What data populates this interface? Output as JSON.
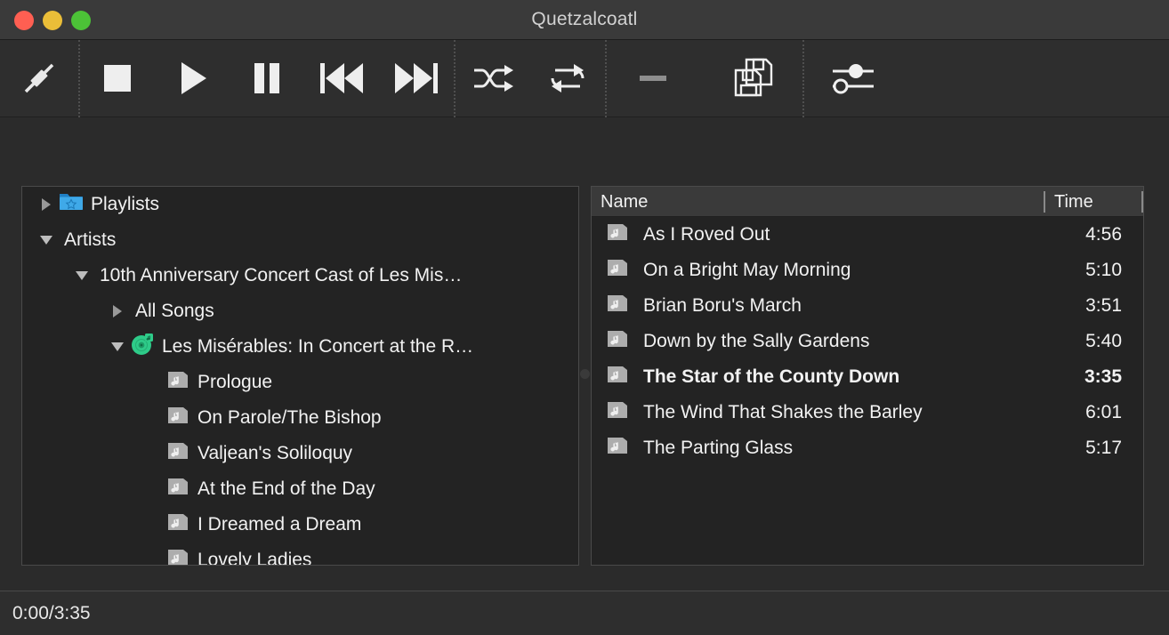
{
  "window": {
    "title": "Quetzalcoatl",
    "controls": [
      {
        "name": "close-button",
        "color": "#ff5f52"
      },
      {
        "name": "minimize-button",
        "color": "#ebbe38"
      },
      {
        "name": "maximize-button",
        "color": "#4cc237"
      }
    ]
  },
  "toolbar": {
    "buttons": [
      {
        "icon": "connect-icon",
        "label": "Connect"
      },
      {
        "icon": "stop-icon",
        "label": "Stop"
      },
      {
        "icon": "play-icon",
        "label": "Play"
      },
      {
        "icon": "pause-icon",
        "label": "Pause"
      },
      {
        "icon": "previous-icon",
        "label": "Previous"
      },
      {
        "icon": "next-icon",
        "label": "Next"
      },
      {
        "icon": "shuffle-icon",
        "label": "Shuffle"
      },
      {
        "icon": "repeat-icon",
        "label": "Repeat"
      },
      {
        "icon": "minus-icon",
        "label": "Remove"
      },
      {
        "icon": "save-icon",
        "label": "Save"
      },
      {
        "icon": "equalizer-icon",
        "label": "Equalizer"
      }
    ]
  },
  "seek": {
    "value": 0,
    "min": 0,
    "max": 100
  },
  "tree": {
    "rows": [
      {
        "depth": 0,
        "twisty": "right",
        "icon": "playlists-folder-icon",
        "label": "Playlists",
        "name": "tree-item-playlists"
      },
      {
        "depth": 0,
        "twisty": "down",
        "icon": "none",
        "label": "Artists",
        "name": "tree-item-artists"
      },
      {
        "depth": 1,
        "twisty": "down",
        "icon": "none",
        "label": "10th Anniversary Concert Cast of Les Mis…",
        "name": "tree-item-artist"
      },
      {
        "depth": 2,
        "twisty": "right",
        "icon": "none",
        "label": "All Songs",
        "name": "tree-item-all-songs"
      },
      {
        "depth": 2,
        "twisty": "down",
        "icon": "album-icon",
        "label": "Les Misérables: In Concert at the R…",
        "name": "tree-item-album"
      },
      {
        "depth": 3,
        "twisty": "none",
        "icon": "music-file-icon",
        "label": "Prologue",
        "name": "tree-item-track"
      },
      {
        "depth": 3,
        "twisty": "none",
        "icon": "music-file-icon",
        "label": "On Parole/The Bishop",
        "name": "tree-item-track"
      },
      {
        "depth": 3,
        "twisty": "none",
        "icon": "music-file-icon",
        "label": "Valjean's Soliloquy",
        "name": "tree-item-track"
      },
      {
        "depth": 3,
        "twisty": "none",
        "icon": "music-file-icon",
        "label": "At the End of the Day",
        "name": "tree-item-track"
      },
      {
        "depth": 3,
        "twisty": "none",
        "icon": "music-file-icon",
        "label": "I Dreamed a Dream",
        "name": "tree-item-track"
      },
      {
        "depth": 3,
        "twisty": "none",
        "icon": "music-file-icon",
        "label": "Lovely Ladies",
        "name": "tree-item-track"
      }
    ]
  },
  "list": {
    "columns": [
      {
        "key": "name",
        "label": "Name"
      },
      {
        "key": "time",
        "label": "Time"
      }
    ],
    "rows": [
      {
        "icon": "music-file-icon",
        "name": "As I Roved Out",
        "time": "4:56",
        "playing": false
      },
      {
        "icon": "music-file-icon",
        "name": "On a Bright May Morning",
        "time": "5:10",
        "playing": false
      },
      {
        "icon": "music-file-icon",
        "name": "Brian Boru's March",
        "time": "3:51",
        "playing": false
      },
      {
        "icon": "music-file-icon",
        "name": "Down by the Sally Gardens",
        "time": "5:40",
        "playing": false
      },
      {
        "icon": "music-file-icon",
        "name": "The Star of the County Down",
        "time": "3:35",
        "playing": true
      },
      {
        "icon": "music-file-icon",
        "name": "The Wind That Shakes the Barley",
        "time": "6:01",
        "playing": false
      },
      {
        "icon": "music-file-icon",
        "name": "The Parting Glass",
        "time": "5:17",
        "playing": false
      }
    ]
  },
  "status": {
    "time": "0:00/3:35"
  },
  "colors": {
    "window_background": "#2b2b2b",
    "panel_background": "#232323",
    "titlebar": "#3a3a3a",
    "text": "#f2f2f2",
    "folder_blue": "#2f9fe0",
    "album_green": "#2fc98a"
  }
}
